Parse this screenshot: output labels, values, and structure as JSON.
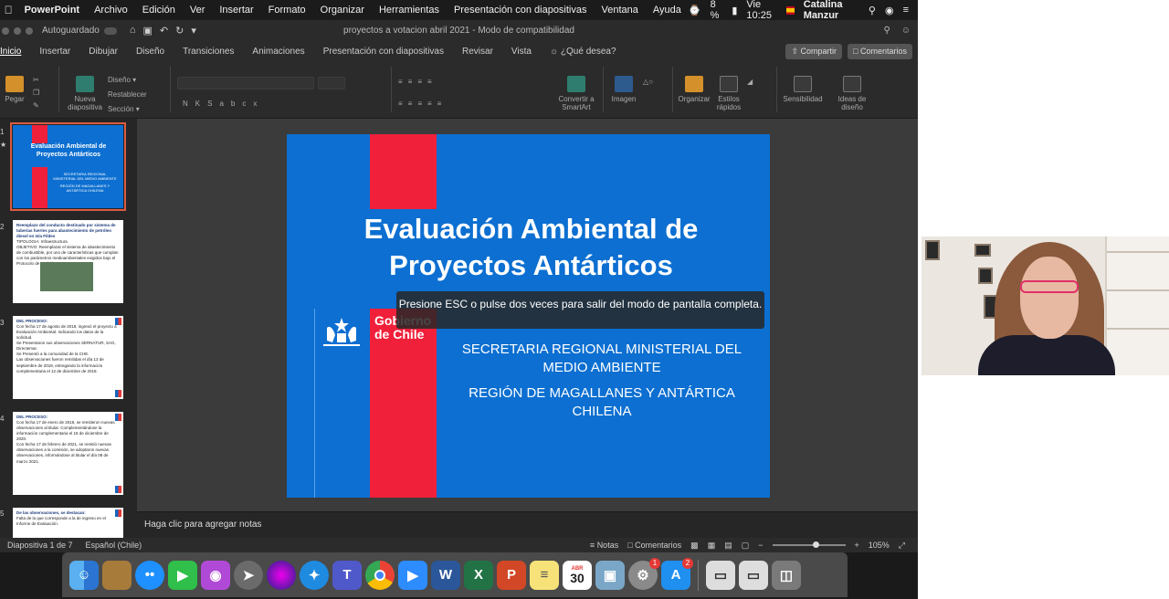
{
  "menubar": {
    "app": "PowerPoint",
    "items": [
      "Archivo",
      "Edición",
      "Ver",
      "Insertar",
      "Formato",
      "Organizar",
      "Herramientas",
      "Presentación con diapositivas",
      "Ventana",
      "Ayuda"
    ],
    "battery": "8 %",
    "clock": "Vie 10:25",
    "user": "Catalina Manzur"
  },
  "titlebar": {
    "autosave": "Autoguardado",
    "doc_title": "proyectos a votacion abril 2021  -  Modo de compatibilidad"
  },
  "ribbon_tabs": {
    "tabs": [
      "Inicio",
      "Insertar",
      "Dibujar",
      "Diseño",
      "Transiciones",
      "Animaciones",
      "Presentación con diapositivas",
      "Revisar",
      "Vista"
    ],
    "search": "¿Qué desea?",
    "share": "Compartir",
    "comments": "Comentarios"
  },
  "ribbon": {
    "paste": "Pegar",
    "new_slide": "Nueva diapositiva",
    "layout": "Diseño",
    "reset": "Restablecer",
    "section": "Sección",
    "convert": "Convertir a SmartArt",
    "image": "Imagen",
    "arrange": "Organizar",
    "quick_styles": "Estilos rápidos",
    "sensitivity": "Sensibilidad",
    "design_ideas": "Ideas de diseño"
  },
  "thumbnails": [
    {
      "number": "1",
      "title": "Evaluación Ambiental de Proyectos Antárticos",
      "lines": [
        "SECRETARIA REGIONAL MINISTERIAL DEL MEDIO AMBIENTE",
        "REGIÓN DE MAGALLANES Y ANTÁRTICA CHILENA"
      ]
    },
    {
      "number": "2",
      "title": "Reemplazo del conducto destinado por sistema de tuberías fuertes para abastecimiento de petróleo diesel en Isla Fildes",
      "lines": [
        "TIPOLOGIA: Infraestructura",
        "OBJETIVO: Reemplazar el sistema de abastecimiento de combustible, por uno de características que cumplan con los parámetros medioambientales exigidos bajo el Protocolo de Madrid."
      ]
    },
    {
      "number": "3",
      "title": "DEL PROCESO:",
      "lines": [
        "Con fecha 17 de agosto de 2018, ingresó el proyecto a Evaluación Ambiental. Indicando los datos de la solicitud.",
        "Se Presentaron sus observaciones SERNATUR, SAG, Directemar.",
        "Se Presentó a la comunidad de la CHE.",
        "Las observaciones fueron remitidas el día 13 de septiembre de 2018, entregando la información complementaria el 12 de diciembre de 2018."
      ]
    },
    {
      "number": "4",
      "title": "DEL PROCESO:",
      "lines": [
        "Con fecha 17 de enero de 2019, se remitieron nuevas observaciones al titular. Complementándose la información complementaria el 18 de diciembre de 2020.",
        "Con fecha 17 de febrero de 2021, se remitió nuevas observaciones a la comisión, se adoptaron nuevas observaciones, informándose al titular el día 08 de marzo 2021."
      ]
    },
    {
      "number": "5",
      "title": "De las observaciones, se destacan:",
      "lines": [
        "Falta de la que corresponde a la de ingreso en el Informe de Evaluación."
      ]
    }
  ],
  "slide": {
    "title": "Evaluación Ambiental de Proyectos Antárticos",
    "logo_text": "Gobierno de Chile",
    "subtitle1": "SECRETARIA REGIONAL MINISTERIAL DEL MEDIO AMBIENTE",
    "subtitle2": "REGIÓN DE MAGALLANES Y ANTÁRTICA CHILENA"
  },
  "overlay": {
    "text": "Presione ESC o pulse dos veces para salir del modo de pantalla completa."
  },
  "notes": {
    "placeholder": "Haga clic para agregar notas"
  },
  "statusbar": {
    "slide_counter": "Diapositiva 1 de 7",
    "language": "Español (Chile)",
    "notes": "Notas",
    "comments": "Comentarios",
    "zoom": "105%"
  },
  "dock": {
    "calendar_month": "ABR",
    "calendar_day": "30",
    "badge_settings": "1",
    "badge_appstore": "2"
  },
  "colors": {
    "slide_blue": "#0c6fd1",
    "slide_red": "#f0203a",
    "chrome_dark": "#2b2b2b"
  }
}
